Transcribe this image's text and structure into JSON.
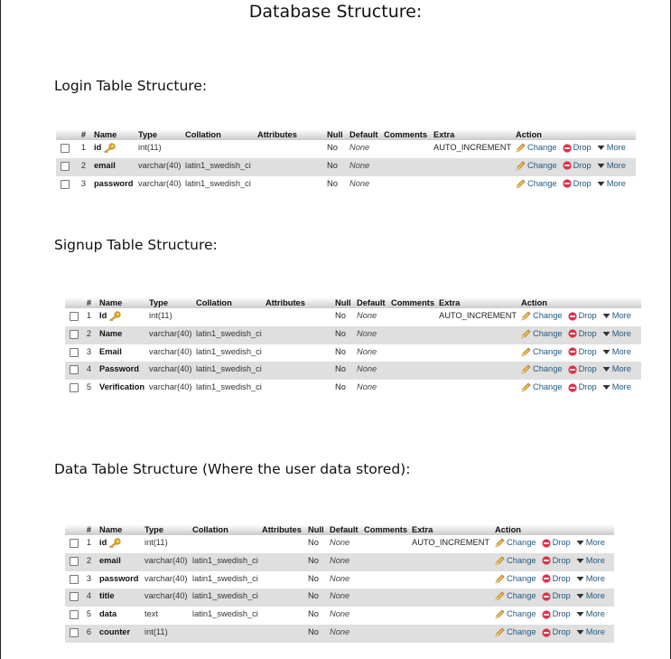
{
  "doc_title": "Database Structure:",
  "headers": [
    "#",
    "Name",
    "Type",
    "Collation",
    "Attributes",
    "Null",
    "Default",
    "Comments",
    "Extra",
    "Action"
  ],
  "actions": {
    "change": "Change",
    "drop": "Drop",
    "more": "More"
  },
  "icons": {
    "primary_key": "key-icon",
    "change": "pencil-icon",
    "drop": "drop-circle-icon",
    "more": "dropdown-triangle-icon",
    "select": "checkbox"
  },
  "colors": {
    "link": "#235a81",
    "drop_icon": "#e0304a",
    "key": "#d9a21b",
    "row_alt": "#dfdfdf"
  },
  "sections": [
    {
      "heading": "Login Table Structure:",
      "rows": [
        {
          "num": "1",
          "name": "id",
          "type": "int(11)",
          "collation": "",
          "attributes": "",
          "null": "No",
          "default": "None",
          "comments": "",
          "extra": "AUTO_INCREMENT",
          "primary": true
        },
        {
          "num": "2",
          "name": "email",
          "type": "varchar(40)",
          "collation": "latin1_swedish_ci",
          "attributes": "",
          "null": "No",
          "default": "None",
          "comments": "",
          "extra": "",
          "primary": false
        },
        {
          "num": "3",
          "name": "password",
          "type": "varchar(40)",
          "collation": "latin1_swedish_ci",
          "attributes": "",
          "null": "No",
          "default": "None",
          "comments": "",
          "extra": "",
          "primary": false
        }
      ]
    },
    {
      "heading": "Signup Table Structure:",
      "rows": [
        {
          "num": "1",
          "name": "Id",
          "type": "int(11)",
          "collation": "",
          "attributes": "",
          "null": "No",
          "default": "None",
          "comments": "",
          "extra": "AUTO_INCREMENT",
          "primary": true
        },
        {
          "num": "2",
          "name": "Name",
          "type": "varchar(40)",
          "collation": "latin1_swedish_ci",
          "attributes": "",
          "null": "No",
          "default": "None",
          "comments": "",
          "extra": "",
          "primary": false
        },
        {
          "num": "3",
          "name": "Email",
          "type": "varchar(40)",
          "collation": "latin1_swedish_ci",
          "attributes": "",
          "null": "No",
          "default": "None",
          "comments": "",
          "extra": "",
          "primary": false
        },
        {
          "num": "4",
          "name": "Password",
          "type": "varchar(40)",
          "collation": "latin1_swedish_ci",
          "attributes": "",
          "null": "No",
          "default": "None",
          "comments": "",
          "extra": "",
          "primary": false
        },
        {
          "num": "5",
          "name": "Verification",
          "type": "varchar(40)",
          "collation": "latin1_swedish_ci",
          "attributes": "",
          "null": "No",
          "default": "None",
          "comments": "",
          "extra": "",
          "primary": false
        }
      ]
    },
    {
      "heading": "Data Table Structure (Where the user data stored):",
      "rows": [
        {
          "num": "1",
          "name": "id",
          "type": "int(11)",
          "collation": "",
          "attributes": "",
          "null": "No",
          "default": "None",
          "comments": "",
          "extra": "AUTO_INCREMENT",
          "primary": true
        },
        {
          "num": "2",
          "name": "email",
          "type": "varchar(40)",
          "collation": "latin1_swedish_ci",
          "attributes": "",
          "null": "No",
          "default": "None",
          "comments": "",
          "extra": "",
          "primary": false
        },
        {
          "num": "3",
          "name": "password",
          "type": "varchar(40)",
          "collation": "latin1_swedish_ci",
          "attributes": "",
          "null": "No",
          "default": "None",
          "comments": "",
          "extra": "",
          "primary": false
        },
        {
          "num": "4",
          "name": "title",
          "type": "varchar(40)",
          "collation": "latin1_swedish_ci",
          "attributes": "",
          "null": "No",
          "default": "None",
          "comments": "",
          "extra": "",
          "primary": false
        },
        {
          "num": "5",
          "name": "data",
          "type": "text",
          "collation": "latin1_swedish_ci",
          "attributes": "",
          "null": "No",
          "default": "None",
          "comments": "",
          "extra": "",
          "primary": false
        },
        {
          "num": "6",
          "name": "counter",
          "type": "int(11)",
          "collation": "",
          "attributes": "",
          "null": "No",
          "default": "None",
          "comments": "",
          "extra": "",
          "primary": false
        }
      ]
    }
  ]
}
